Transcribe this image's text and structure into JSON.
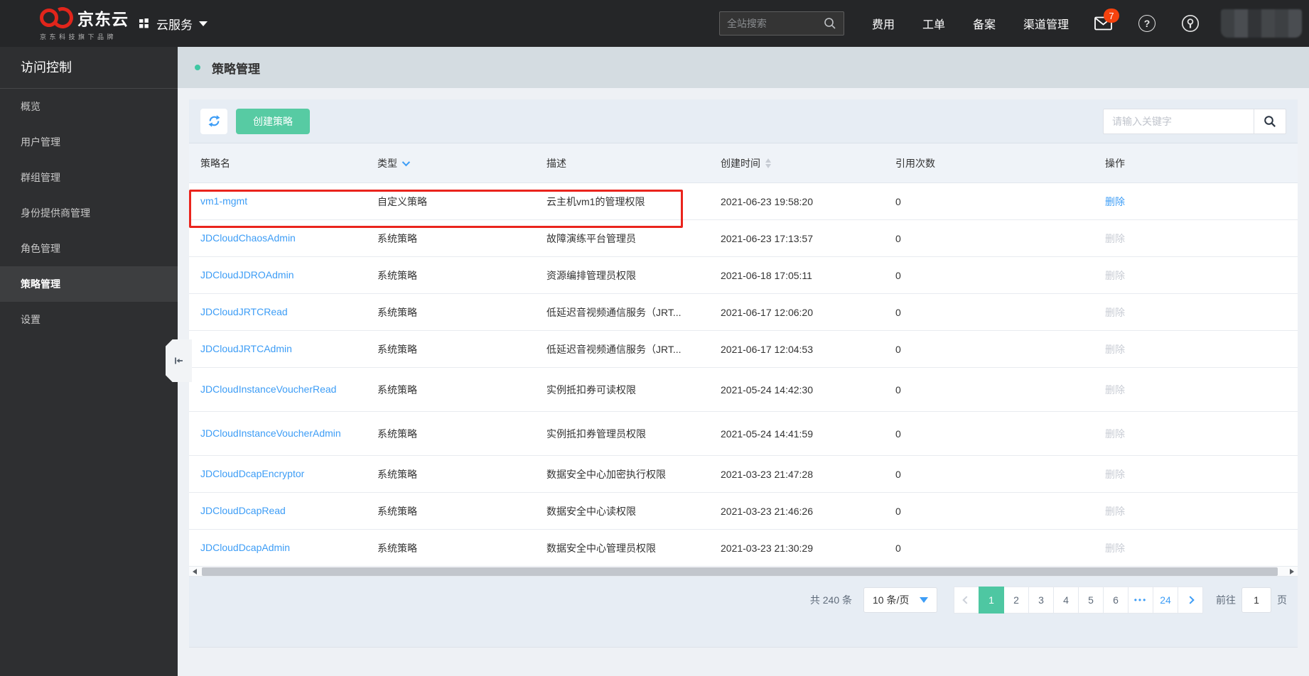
{
  "topbar": {
    "brand_name": "京东云",
    "brand_subtitle": "京东科技旗下品牌",
    "product_switcher": "云服务",
    "search_placeholder": "全站搜索",
    "nav": [
      "费用",
      "工单",
      "备案",
      "渠道管理"
    ],
    "mail_badge": "7"
  },
  "icons": {
    "help_glyph": "?",
    "logo": "jd-double-ring",
    "mail": "envelope",
    "search": "magnifier",
    "refresh": "circular-arrows",
    "account": "keyhole-circle",
    "collapse": "arrow-to-left-bar"
  },
  "sidebar": {
    "title": "访问控制",
    "items": [
      {
        "label": "概览",
        "active": false
      },
      {
        "label": "用户管理",
        "active": false
      },
      {
        "label": "群组管理",
        "active": false
      },
      {
        "label": "身份提供商管理",
        "active": false
      },
      {
        "label": "角色管理",
        "active": false
      },
      {
        "label": "策略管理",
        "active": true
      },
      {
        "label": "设置",
        "active": false
      }
    ]
  },
  "page": {
    "title": "策略管理"
  },
  "toolbar": {
    "create_label": "创建策略",
    "keyword_placeholder": "请输入关键字"
  },
  "table": {
    "columns": [
      "策略名",
      "类型",
      "描述",
      "创建时间",
      "引用次数",
      "操作"
    ],
    "delete_label": "删除",
    "rows": [
      {
        "name": "vm1-mgmt",
        "type": "自定义策略",
        "desc": "云主机vm1的管理权限",
        "created": "2021-06-23 19:58:20",
        "refs": "0",
        "deletable": true,
        "highlighted": true
      },
      {
        "name": "JDCloudChaosAdmin",
        "type": "系统策略",
        "desc": "故障演练平台管理员",
        "created": "2021-06-23 17:13:57",
        "refs": "0",
        "deletable": false
      },
      {
        "name": "JDCloudJDROAdmin",
        "type": "系统策略",
        "desc": "资源编排管理员权限",
        "created": "2021-06-18 17:05:11",
        "refs": "0",
        "deletable": false
      },
      {
        "name": "JDCloudJRTCRead",
        "type": "系统策略",
        "desc": "低延迟音视频通信服务（JRT...",
        "created": "2021-06-17 12:06:20",
        "refs": "0",
        "deletable": false
      },
      {
        "name": "JDCloudJRTCAdmin",
        "type": "系统策略",
        "desc": "低延迟音视频通信服务（JRT...",
        "created": "2021-06-17 12:04:53",
        "refs": "0",
        "deletable": false
      },
      {
        "name": "JDCloudInstanceVoucherRead",
        "type": "系统策略",
        "desc": "实例抵扣券可读权限",
        "created": "2021-05-24 14:42:30",
        "refs": "0",
        "deletable": false
      },
      {
        "name": "JDCloudInstanceVoucherAdmin",
        "type": "系统策略",
        "desc": "实例抵扣券管理员权限",
        "created": "2021-05-24 14:41:59",
        "refs": "0",
        "deletable": false
      },
      {
        "name": "JDCloudDcapEncryptor",
        "type": "系统策略",
        "desc": "数据安全中心加密执行权限",
        "created": "2021-03-23 21:47:28",
        "refs": "0",
        "deletable": false
      },
      {
        "name": "JDCloudDcapRead",
        "type": "系统策略",
        "desc": "数据安全中心读权限",
        "created": "2021-03-23 21:46:26",
        "refs": "0",
        "deletable": false
      },
      {
        "name": "JDCloudDcapAdmin",
        "type": "系统策略",
        "desc": "数据安全中心管理员权限",
        "created": "2021-03-23 21:30:29",
        "refs": "0",
        "deletable": false
      }
    ]
  },
  "pagination": {
    "total": "共 240 条",
    "page_size": "10 条/页",
    "pages": [
      {
        "label": "1",
        "active": true
      },
      {
        "label": "2",
        "active": false
      },
      {
        "label": "3",
        "active": false
      },
      {
        "label": "4",
        "active": false
      },
      {
        "label": "5",
        "active": false
      },
      {
        "label": "6",
        "active": false
      },
      {
        "label": "•••",
        "active": false
      },
      {
        "label": "24",
        "active": false
      }
    ],
    "goto_label": "前往",
    "goto_value": "1",
    "goto_suffix": "页"
  },
  "colors": {
    "brand_red": "#e1251b",
    "badge_orange": "#f5420e",
    "accent_green": "#57cba3",
    "active_page_green": "#4ec7a2",
    "link_blue": "#3d9df6",
    "header_band": "#d4dce1",
    "panel_band": "#e7edf4",
    "highlight_red": "#ea241d"
  }
}
